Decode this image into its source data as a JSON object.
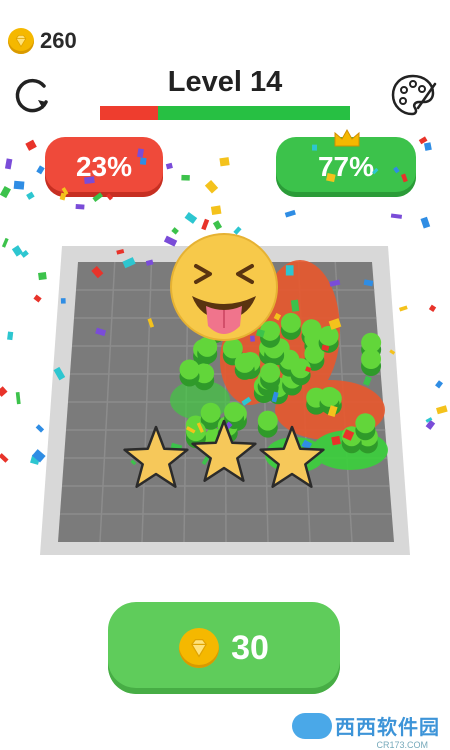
{
  "hud": {
    "coins": "260",
    "level_title": "Level 14",
    "progress_red_fraction": 0.23
  },
  "score": {
    "red_percent": "23%",
    "green_percent": "77%"
  },
  "result": {
    "stars_earned": 3,
    "stars_total": 3,
    "emoji": "laughing-tongue-face"
  },
  "reward": {
    "amount": "30"
  },
  "watermark": {
    "text": "西西软件园",
    "sub": "CR173.COM"
  },
  "colors": {
    "red": "#ef4a3a",
    "green": "#3cc24b",
    "coin": "#f5b800",
    "star": "#f6c85a"
  }
}
